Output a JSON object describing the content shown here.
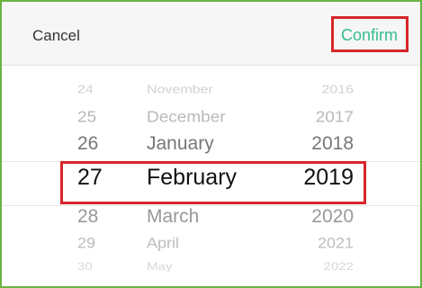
{
  "header": {
    "cancel_label": "Cancel",
    "confirm_label": "Confirm"
  },
  "picker": {
    "days": [
      "24",
      "25",
      "26",
      "27",
      "28",
      "29",
      "30"
    ],
    "months": [
      "November",
      "December",
      "January",
      "February",
      "March",
      "April",
      "May"
    ],
    "years": [
      "2016",
      "2017",
      "2018",
      "2019",
      "2020",
      "2021",
      "2022"
    ],
    "selected": {
      "day": "27",
      "month": "February",
      "year": "2019"
    }
  },
  "colors": {
    "frame_border": "#6cb245",
    "highlight_border": "#d7262a",
    "confirm_text": "#35be8c"
  }
}
